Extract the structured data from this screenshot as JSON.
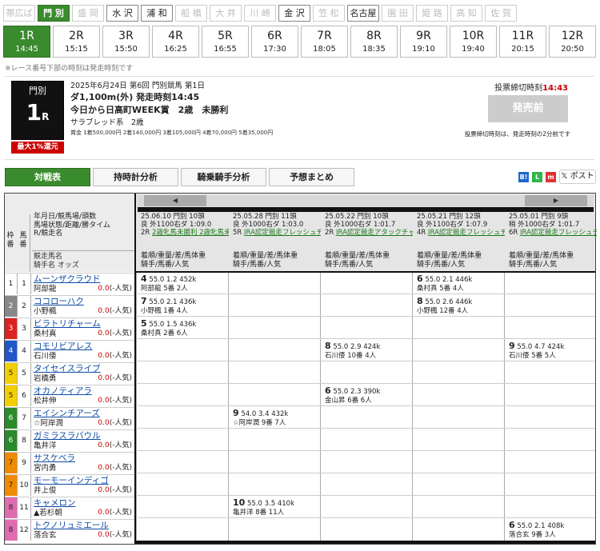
{
  "venues": [
    {
      "label": "帯広ば",
      "state": "off"
    },
    {
      "label": "門 別",
      "state": "current"
    },
    {
      "label": "盛 岡",
      "state": "off"
    },
    {
      "label": "水 沢",
      "state": "on"
    },
    {
      "label": "浦 和",
      "state": "on"
    },
    {
      "label": "船 橋",
      "state": "off"
    },
    {
      "label": "大 井",
      "state": "off"
    },
    {
      "label": "川 崎",
      "state": "off"
    },
    {
      "label": "金 沢",
      "state": "on"
    },
    {
      "label": "笠 松",
      "state": "off"
    },
    {
      "label": "名古屋",
      "state": "on"
    },
    {
      "label": "園 田",
      "state": "off"
    },
    {
      "label": "姫 路",
      "state": "off"
    },
    {
      "label": "高 知",
      "state": "off"
    },
    {
      "label": "佐 賀",
      "state": "off"
    }
  ],
  "races": [
    {
      "label": "1R",
      "time": "14:45"
    },
    {
      "label": "2R",
      "time": "15:15"
    },
    {
      "label": "3R",
      "time": "15:50"
    },
    {
      "label": "4R",
      "time": "16:25"
    },
    {
      "label": "5R",
      "time": "16:55"
    },
    {
      "label": "6R",
      "time": "17:30"
    },
    {
      "label": "7R",
      "time": "18:05"
    },
    {
      "label": "8R",
      "time": "18:35"
    },
    {
      "label": "9R",
      "time": "19:10"
    },
    {
      "label": "10R",
      "time": "19:40"
    },
    {
      "label": "11R",
      "time": "20:15"
    },
    {
      "label": "12R",
      "time": "20:50"
    }
  ],
  "note": "※レース番号下部の時刻は発走時刻です",
  "race": {
    "venue": "門別",
    "num": "1",
    "num_suffix": "R",
    "max": "最大1%還元",
    "date": "2025年6月24日 第6回 門別競馬 第1日",
    "course": "ダ1,100m(外) 発走時刻14:45",
    "name": "今日から日高町WEEK賞　2歳　未勝利",
    "kind": "サラブレッド系　2歳",
    "prize": "賞金 1着500,000円 2着140,000円 3着105,000円 4着70,000円 5着35,000円"
  },
  "deadline": {
    "label": "投票締切時刻",
    "time": "14:43"
  },
  "pre_label": "発売前",
  "pre_note": "投票締切時刻は、発走時刻の2分前です",
  "tabs": [
    "対戦表",
    "持時計分析",
    "騎乗騎手分析",
    "予想まとめ"
  ],
  "share": {
    "post": "ポスト"
  },
  "table_head": {
    "waku": "枠番",
    "uma": "馬番",
    "l1": "年月日/競馬場/頭数",
    "l2": "馬場状態/距離/勝タイム",
    "l3": "R/競走名",
    "l4": "競走馬名",
    "l5": "騎手名 オッズ",
    "scroll_left": "◀",
    "scroll_right": "▶"
  },
  "past": [
    {
      "l1": "25.06.10  門別  10頭",
      "l2": "良  外1100右ダ  1:09.0",
      "l3a": "2R",
      "l3b": "2歳牝馬未勝利  2歳牝馬未勝利"
    },
    {
      "l1": "25.05.28  門別  11頭",
      "l2": "良  外1000右ダ  1:03.0",
      "l3a": "5R",
      "l3b": "JRA認定競走フレッシュチャレンジ"
    },
    {
      "l1": "25.05.22  門別  10頭",
      "l2": "良  外1000右ダ  1:01.7",
      "l3a": "2R",
      "l3b": "JRA認定競走アタックチャレンジ"
    },
    {
      "l1": "25.05.21  門別  12頭",
      "l2": "良  外1100右ダ  1:07.9",
      "l3a": "4R",
      "l3b": "JRA認定競走フレッシュチャレンジ"
    },
    {
      "l1": "25.05.01  門別  9頭",
      "l2": "稍  外1000右ダ  1:01.7",
      "l3a": "6R",
      "l3b": "JRA認定競走フレッシュチャレンジ"
    }
  ],
  "past_sub": {
    "a": "着順/重量/差/馬体重",
    "b": "騎手/馬番/人気"
  },
  "horses": [
    {
      "waku": "1",
      "uma": "1",
      "name": "ムーンザクラウド",
      "jockey": "阿部龍",
      "odds": "0.0",
      "pop": "(-人気)"
    },
    {
      "waku": "2",
      "uma": "2",
      "name": "ココローハク",
      "jockey": "小野楓",
      "odds": "0.0",
      "pop": "(-人気)"
    },
    {
      "waku": "3",
      "uma": "3",
      "name": "ビラトリチャーム",
      "jockey": "桑村真",
      "odds": "0.0",
      "pop": "(-人気)"
    },
    {
      "waku": "4",
      "uma": "4",
      "name": "コモリビアレス",
      "jockey": "石川倭",
      "odds": "0.0",
      "pop": "(-人気)"
    },
    {
      "waku": "5",
      "uma": "5",
      "name": "タイセイスライブ",
      "jockey": "岩橋勇",
      "odds": "0.0",
      "pop": "(-人気)"
    },
    {
      "waku": "5",
      "uma": "6",
      "name": "オカノティアラ",
      "jockey": "松井伸",
      "odds": "0.0",
      "pop": "(-人気)"
    },
    {
      "waku": "6",
      "uma": "7",
      "name": "エイシンチアーズ",
      "jockey": "☆阿岸潤",
      "odds": "0.0",
      "pop": "(-人気)"
    },
    {
      "waku": "6",
      "uma": "8",
      "name": "ガミラスラバウル",
      "jockey": "亀井洋",
      "odds": "0.0",
      "pop": "(-人気)"
    },
    {
      "waku": "7",
      "uma": "9",
      "name": "サスケベラ",
      "jockey": "宮内勇",
      "odds": "0.0",
      "pop": "(-人気)"
    },
    {
      "waku": "7",
      "uma": "10",
      "name": "モーモーインディゴ",
      "jockey": "井上俊",
      "odds": "0.0",
      "pop": "(-人気)"
    },
    {
      "waku": "8",
      "uma": "11",
      "name": "キャメロン",
      "jockey": "▲若杉朝",
      "odds": "0.0",
      "pop": "(-人気)"
    },
    {
      "waku": "8",
      "uma": "12",
      "name": "トクノリュミエール",
      "jockey": "落合玄",
      "odds": "0.0",
      "pop": "(-人気)"
    }
  ],
  "results": [
    {
      "row": 0,
      "col": 0,
      "pos": "4",
      "a": "55.0  1.2  452k",
      "b": "阿部龍  5番  2人"
    },
    {
      "row": 0,
      "col": 3,
      "pos": "6",
      "a": "55.0  2.1  446k",
      "b": "桑村真  5番  4人"
    },
    {
      "row": 1,
      "col": 0,
      "pos": "7",
      "a": "55.0  2.1  436k",
      "b": "小野楓  1番  4人"
    },
    {
      "row": 1,
      "col": 3,
      "pos": "8",
      "a": "55.0  2.6  446k",
      "b": "小野楓  12番  4人"
    },
    {
      "row": 2,
      "col": 0,
      "pos": "5",
      "a": "55.0  1.5  436k",
      "b": "桑村真  2番  6人"
    },
    {
      "row": 3,
      "col": 2,
      "pos": "8",
      "a": "55.0  2.9  424k",
      "b": "石川倭  10番  4人"
    },
    {
      "row": 3,
      "col": 4,
      "pos": "9",
      "a": "55.0  4.7  424k",
      "b": "石川倭  5番  5人"
    },
    {
      "row": 5,
      "col": 2,
      "pos": "6",
      "a": "55.0  2.3  390k",
      "b": "金山昇  6番  6人"
    },
    {
      "row": 6,
      "col": 1,
      "pos": "9",
      "a": "54.0  3.4  432k",
      "b": "☆阿岸潤  9番  7人"
    },
    {
      "row": 10,
      "col": 1,
      "pos": "10",
      "a": "55.0  3.5  410k",
      "b": "亀井洋  8番  11人"
    },
    {
      "row": 11,
      "col": 4,
      "pos": "6",
      "a": "55.0  2.1  408k",
      "b": "落合玄  9番  3人"
    }
  ],
  "colors": {
    "accent": "#3a8b2d",
    "deadline": "#cc0000",
    "link": "#0b4aa5",
    "odds": "#cc0000"
  }
}
